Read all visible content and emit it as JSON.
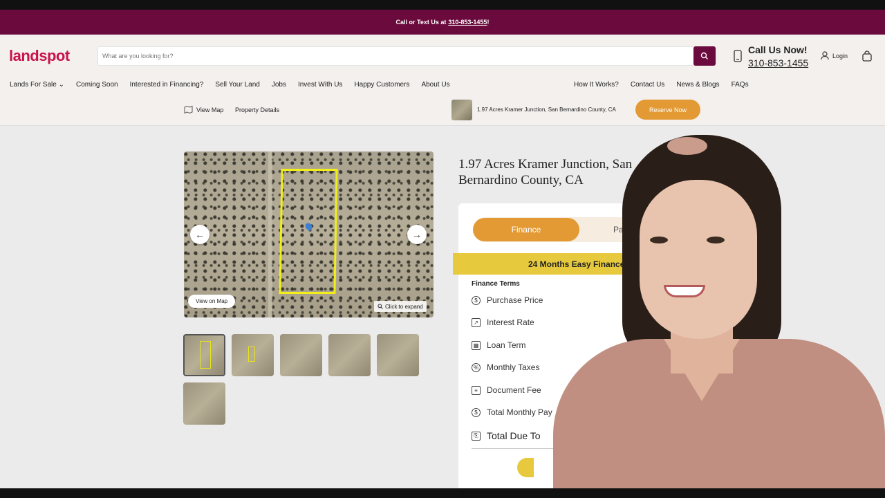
{
  "promo": {
    "text": "Call or Text Us at",
    "phone": "310-853-1455",
    "suffix": "!"
  },
  "header": {
    "logo": "landspot",
    "search_placeholder": "What are you looking for?",
    "call_label": "Call Us Now!",
    "call_number": "310-853-1455",
    "login": "Login"
  },
  "nav_left": [
    "Lands For Sale ⌄",
    "Coming Soon",
    "Interested in Financing?",
    "Sell Your Land",
    "Jobs",
    "Invest With Us",
    "Happy Customers",
    "About Us"
  ],
  "nav_right": [
    "How It Works?",
    "Contact Us",
    "News & Blogs",
    "FAQs"
  ],
  "subbar": {
    "view_map": "View Map",
    "property_details": "Property Details",
    "listing": "1.97 Acres Kramer Junction, San Bernardino County, CA",
    "reserve": "Reserve Now"
  },
  "gallery": {
    "view_on_map": "View on Map",
    "expand": "Click to expand"
  },
  "listing": {
    "title": "1.97 Acres Kramer Junction, San Bernardino County, CA",
    "tab_finance": "Finance",
    "tab_pay": "Pa",
    "banner": "24 Months Easy Finance",
    "finance_terms": "Finance Terms",
    "rows": [
      "Purchase Price",
      "Interest Rate",
      "Loan Term",
      "Monthly Taxes",
      "Document Fee",
      "Total Monthly Pay",
      "Total Due To"
    ]
  }
}
